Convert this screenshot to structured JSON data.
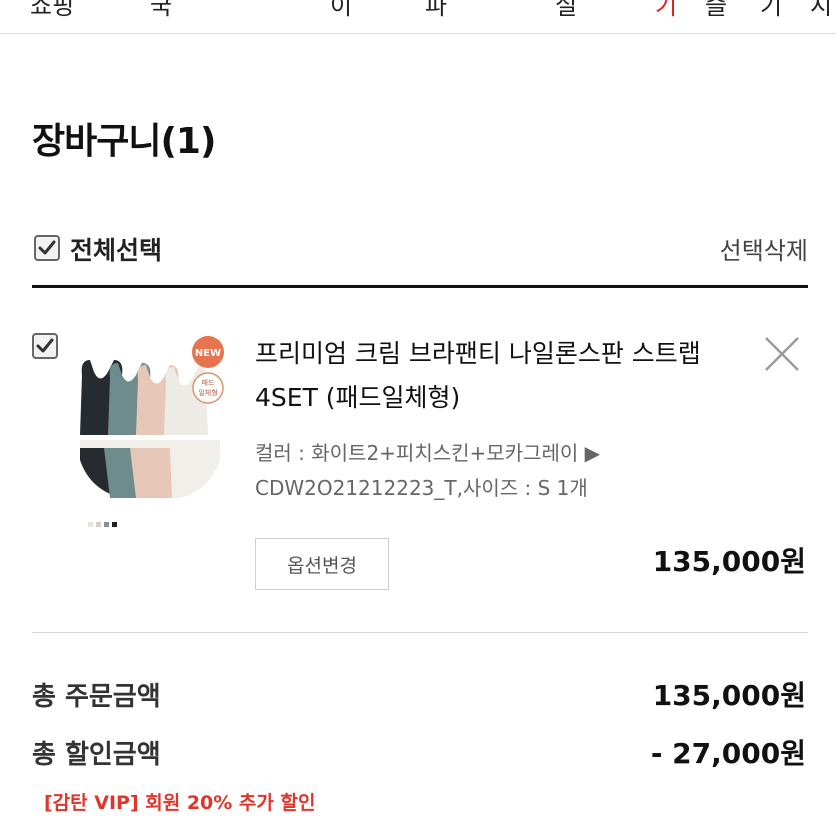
{
  "top_nav": {
    "fragments": [
      "쇼핑",
      "국",
      "이",
      "파",
      "실",
      "기",
      "즐",
      "기",
      "시"
    ]
  },
  "cart": {
    "title": "장바구니(1)",
    "select_all_label": "전체선택",
    "select_all_checked": true,
    "delete_selected_label": "선택삭제"
  },
  "item": {
    "checked": true,
    "badge_new": "NEW",
    "badge_type": "패드\n일체형",
    "name": "프리미엄 크림 브라팬티 나일론스판 스트랩 4SET (패드일체형)",
    "option_line1": "컬러 : 화이트2+피치스킨+모카그레이 ▶",
    "option_line2": "CDW2O21212223_T,사이즈 : S 1개",
    "option_button_label": "옵션변경",
    "price": "135,000원",
    "swatch_colors": [
      "#e8e3da",
      "#d7d0c6",
      "#8a8f93",
      "#222222"
    ]
  },
  "summary": {
    "order_label": "총 주문금액",
    "order_value": "135,000원",
    "discount_label": "총 할인금액",
    "discount_value": "- 27,000원",
    "promo_text": "[감탄 VIP] 회원 20% 추가 할인"
  },
  "colors": {
    "accent_red": "#e0352b",
    "text_dark": "#111111",
    "text_gray": "#666666"
  }
}
